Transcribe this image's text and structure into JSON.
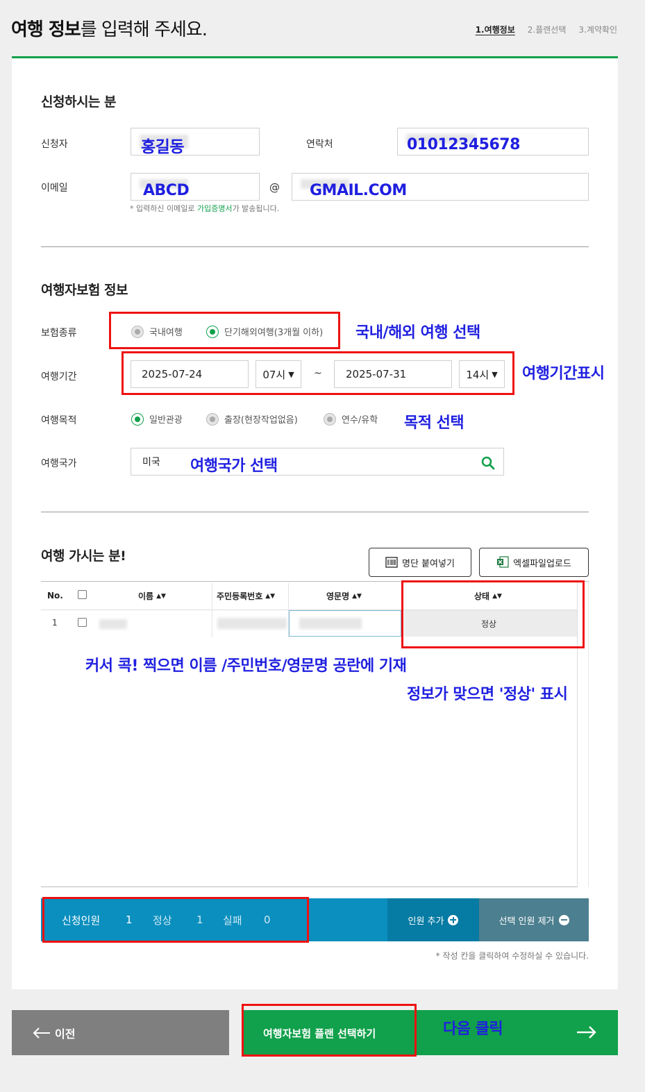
{
  "header": {
    "title_bold": "여행 정보",
    "title_rest": "를 입력해 주세요.",
    "steps": [
      "1.여행정보",
      "2.플랜선택",
      "3.계약확인"
    ]
  },
  "applicant": {
    "section_title": "신청하시는 분",
    "name_label": "신청자",
    "name_value": "홍길동",
    "phone_label": "연락처",
    "phone_value": "01012345678",
    "email_label": "이메일",
    "email_local": "ABCD",
    "email_at": "@",
    "email_domain": "GMAIL.COM",
    "note_prefix": "* 입력하신 이메일로 ",
    "note_highlight": "가입증명서",
    "note_suffix": "가 발송됩니다."
  },
  "insurance": {
    "section_title": "여행자보험 정보",
    "type_label": "보험종류",
    "type_options": [
      "국내여행",
      "단기해외여행(3개월 이하)"
    ],
    "type_selected": "단기해외여행(3개월 이하)",
    "period_label": "여행기간",
    "start_date": "2025-07-24",
    "start_hour": "07시",
    "tilde": "~",
    "end_date": "2025-07-31",
    "end_hour": "14시",
    "purpose_label": "여행목적",
    "purpose_options": [
      "일반관광",
      "출장(현장작업없음)",
      "연수/유학"
    ],
    "purpose_selected": "일반관광",
    "country_label": "여행국가",
    "country_value": "미국"
  },
  "travelers": {
    "section_title": "여행 가시는 분!",
    "paste_button": "명단 붙여넣기",
    "excel_button": "엑셀파일업로드",
    "columns": [
      "No.",
      "이름",
      "주민등록번호",
      "영문명",
      "상태"
    ],
    "rows": [
      {
        "no": "1",
        "status": "정상"
      }
    ]
  },
  "summary": {
    "applied_label": "신청인원",
    "applied_count": "1",
    "normal_label": "정상",
    "normal_count": "1",
    "fail_label": "실패",
    "fail_count": "0",
    "add_button": "인원 추가",
    "remove_button": "선택 인원 제거",
    "note": "* 작성 칸을 클릭하여 수정하실 수 있습니다."
  },
  "footer": {
    "prev_button": "이전",
    "next_button": "여행자보험 플랜 선택하기"
  },
  "annotations": {
    "type_hint": "국내/해외 여행 선택",
    "period_hint": "여행기간표시",
    "purpose_hint": "목적 선택",
    "country_hint": "여행국가 선택",
    "fill_hint": "커서 콕! 찍으면 이름 /주민번호/영문명 공란에 기재",
    "status_hint": "정보가 맞으면 '정상' 표시",
    "next_hint": "다음 클릭"
  },
  "colors": {
    "brand_green": "#11a04b",
    "bar_blue": "#0b8fbf",
    "annotation_blue": "#1f1fe0",
    "highlight_red": "#e11111"
  }
}
